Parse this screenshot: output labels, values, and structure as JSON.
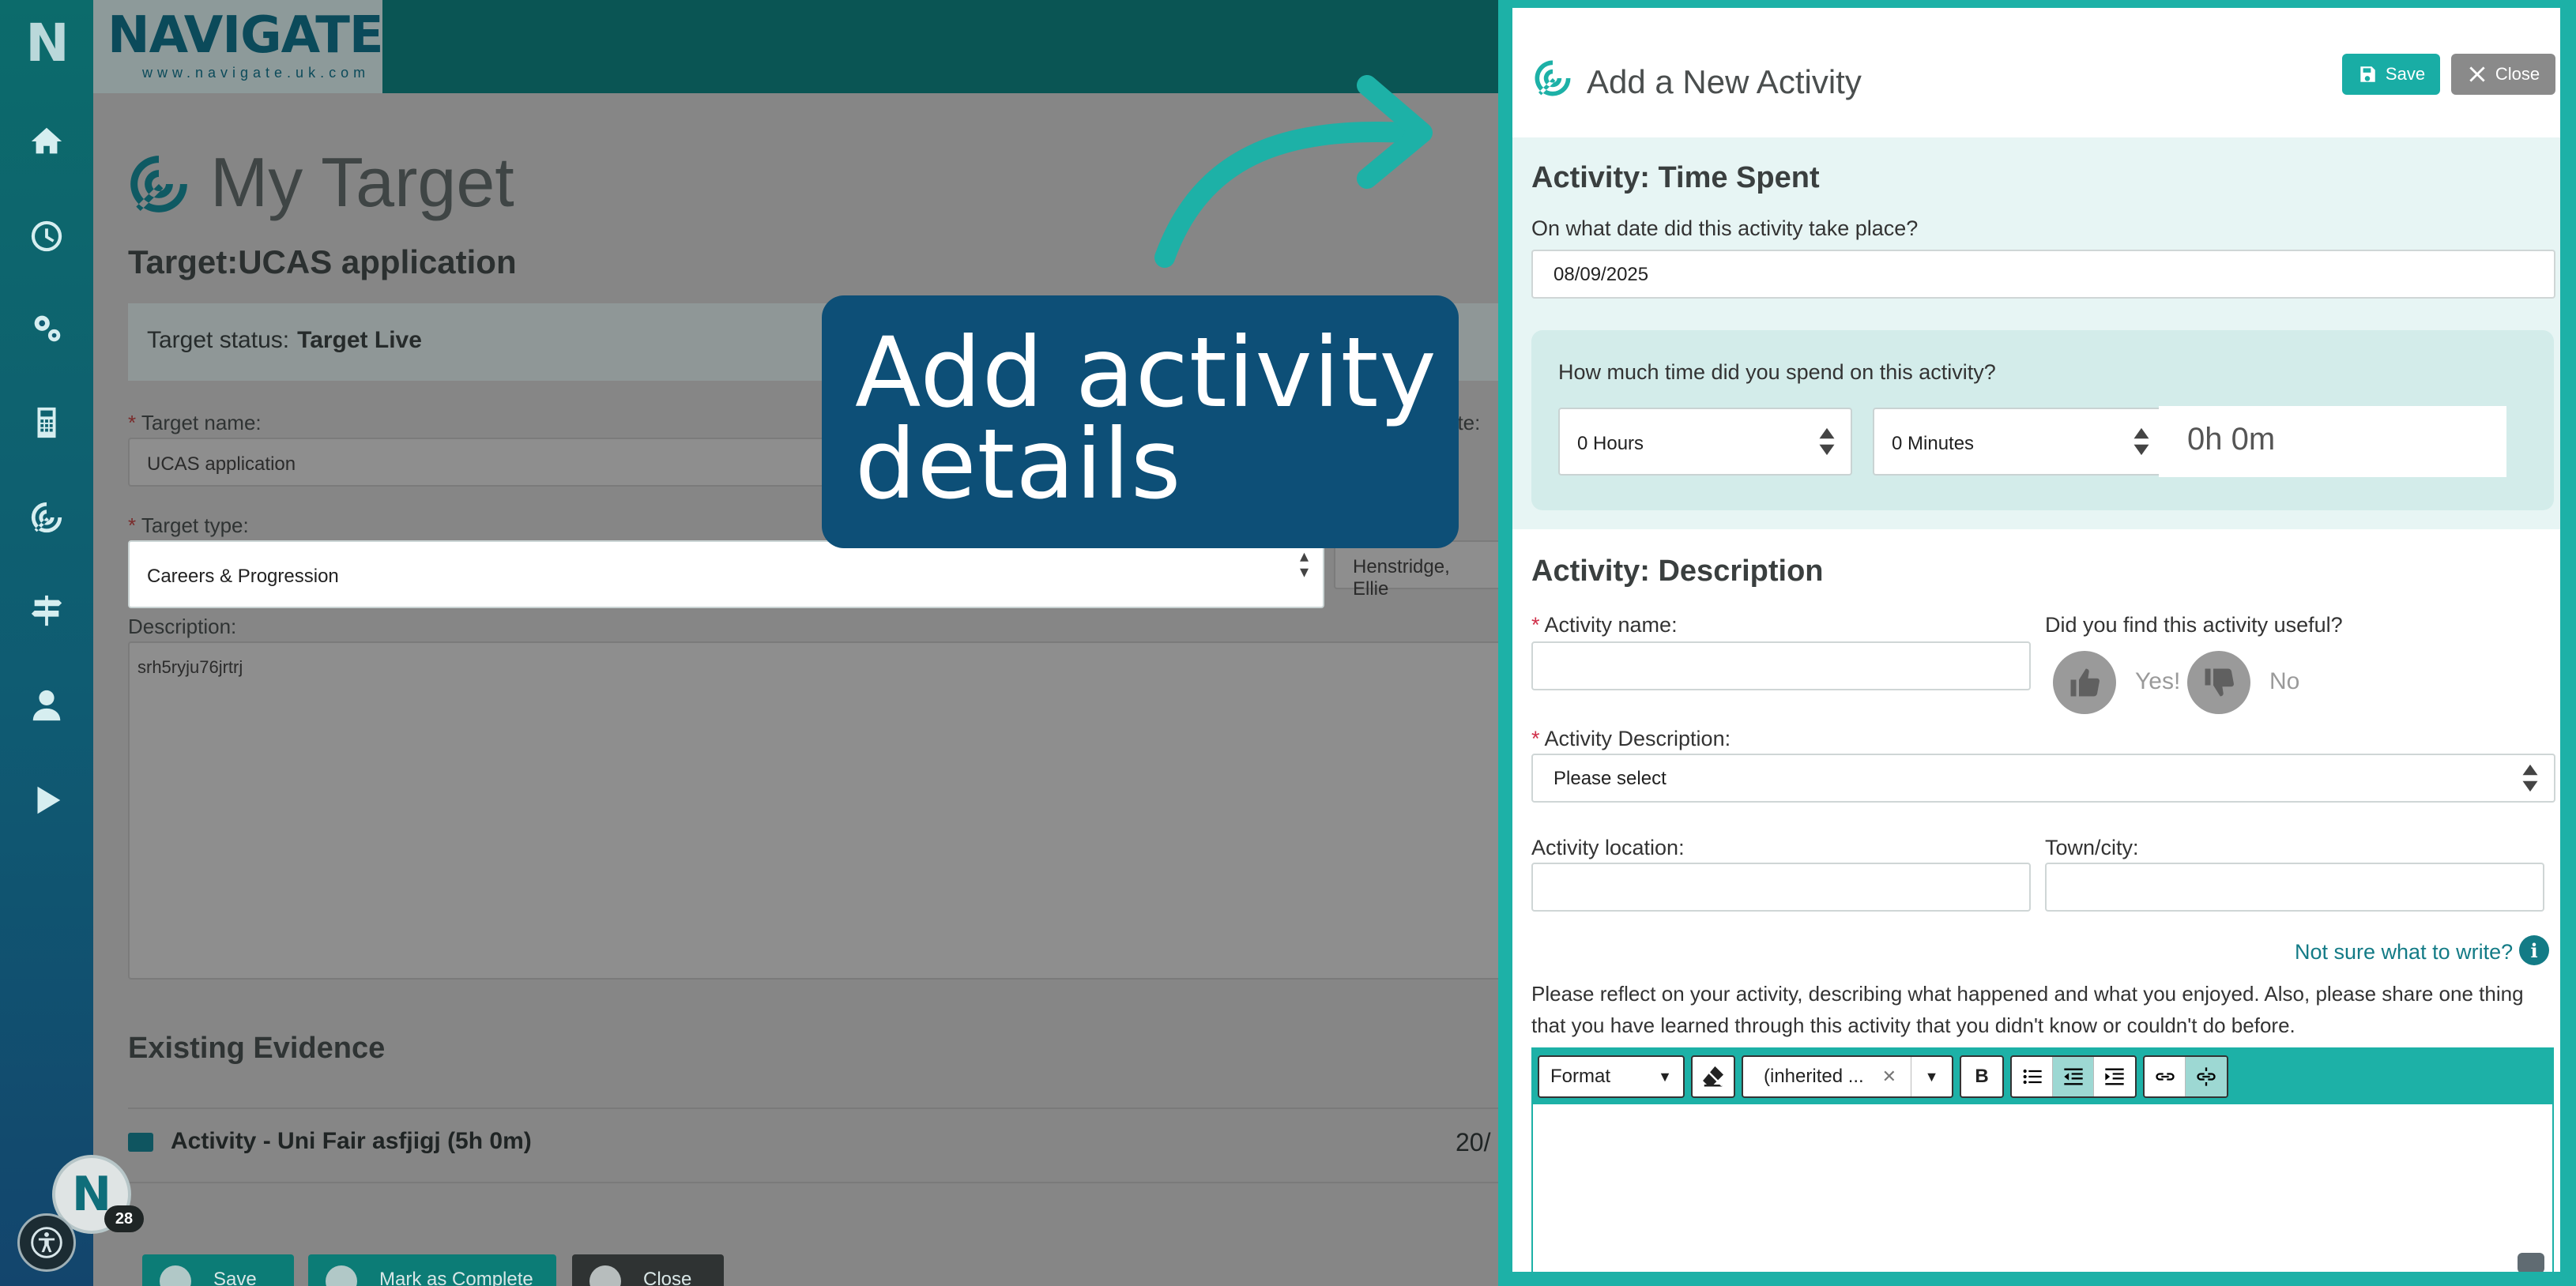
{
  "background": {
    "brand": {
      "name": "NAVIGATE",
      "url": "www.navigate.uk.com"
    },
    "page_title": "My Target",
    "target_heading": "Target:UCAS application",
    "status": {
      "label": "Target status:",
      "value": "Target Live"
    },
    "fields": {
      "target_name_label": "Target name:",
      "target_name_value": "UCAS application",
      "target_type_label": "Target type:",
      "target_type_value": "Careers & Progression",
      "assigned_value": "Henstridge, Ellie",
      "partial_label": "ate:",
      "description_label": "Description:",
      "description_value": "srh5ryju76jrtrj"
    },
    "evidence": {
      "heading": "Existing Evidence",
      "item": "Activity - Uni Fair asfjigj (5h 0m)",
      "date_partial": "20/"
    },
    "buttons": {
      "save": "Save",
      "complete": "Mark as Complete",
      "close": "Close"
    },
    "fab": {
      "letter": "N",
      "badge": "28"
    }
  },
  "callout": {
    "text": "Add activity details"
  },
  "drawer": {
    "title": "Add a New Activity",
    "save_label": "Save",
    "close_label": "Close",
    "time_spent": {
      "heading": "Activity: Time Spent",
      "date_question": "On what date did this activity take place?",
      "date_value": "08/09/2025",
      "time_question": "How much time did you spend on this activity?",
      "hours_value": "0 Hours",
      "minutes_value": "0 Minutes",
      "total": "0h 0m"
    },
    "description": {
      "heading": "Activity: Description",
      "name_label": "Activity name:",
      "useful_question": "Did you find this activity useful?",
      "yes_label": "Yes!",
      "no_label": "No",
      "desc_label": "Activity Description:",
      "desc_value": "Please select",
      "location_label": "Activity location:",
      "town_label": "Town/city:",
      "help_link": "Not sure what to write?",
      "reflect_text": "Please reflect on your activity, describing what happened and what you enjoyed. Also, please share one thing that you have learned through this activity that you didn't know or couldn't do before."
    },
    "editor": {
      "format_label": "Format",
      "font_label": "(inherited ...",
      "bold_label": "B"
    }
  },
  "colors": {
    "accent": "#1db1a7",
    "link": "#137b86",
    "required": "#d0304a",
    "callout": "#0d4f77"
  }
}
